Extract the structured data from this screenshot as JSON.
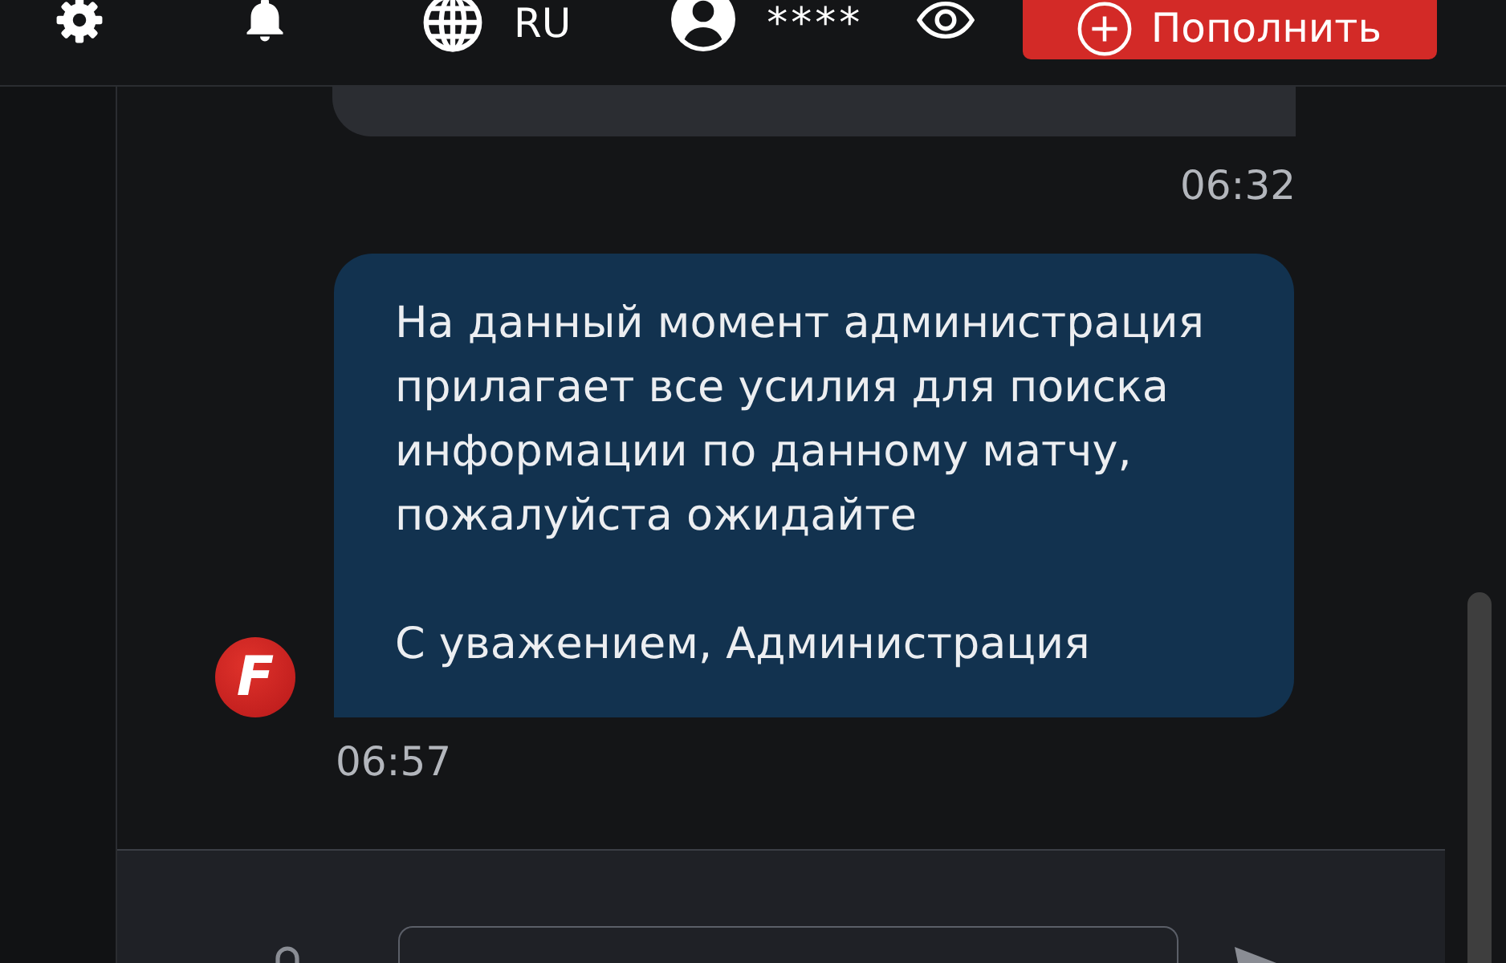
{
  "header": {
    "language": "RU",
    "balance": "****",
    "top_up_button": "Пополнить"
  },
  "messages": [
    {
      "kind": "outgoing",
      "time": "06:32"
    },
    {
      "kind": "incoming",
      "sender_logo": "F",
      "paragraphs": [
        "На данный момент администрация прилагает все усилия для поиска информации по данному матчу, пожалуйста ожидайте",
        "С уважением, Администрация"
      ],
      "time": "06:57"
    }
  ]
}
